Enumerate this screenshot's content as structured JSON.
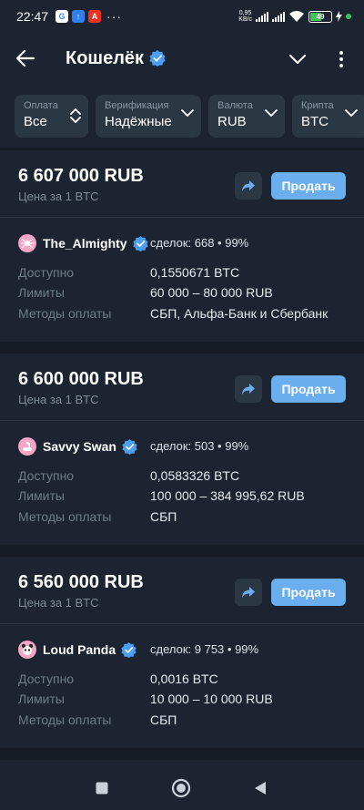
{
  "status_bar": {
    "time": "22:47",
    "net_speed_value": "0,95",
    "net_speed_unit": "KB/c",
    "battery": "49",
    "app_icons": [
      "google-icon",
      "upload-icon",
      "alfa-bank-icon"
    ],
    "more_dots": "···"
  },
  "header": {
    "title": "Кошелёк"
  },
  "filters": [
    {
      "label": "Оплата",
      "value": "Все"
    },
    {
      "label": "Верификация",
      "value": "Надёжные"
    },
    {
      "label": "Валюта",
      "value": "RUB"
    },
    {
      "label": "Крипта",
      "value": "BTC"
    }
  ],
  "offers": [
    {
      "price": "6 607 000 RUB",
      "price_sub": "Цена за 1 BTC",
      "sell_label": "Продать",
      "merchant": "The_Almighty",
      "deals": "сделок: 668 • 99%",
      "available_label": "Доступно",
      "available": "0,1550671 BTC",
      "limits_label": "Лимиты",
      "limits": "60 000 – 80 000 RUB",
      "methods_label": "Методы оплаты",
      "methods": "СБП, Альфа-Банк и Сбербанк"
    },
    {
      "price": "6 600 000 RUB",
      "price_sub": "Цена за 1 BTC",
      "sell_label": "Продать",
      "merchant": "Savvy Swan",
      "deals": "сделок: 503 • 99%",
      "available_label": "Доступно",
      "available": "0,0583326 BTC",
      "limits_label": "Лимиты",
      "limits": "100 000 – 384 995,62 RUB",
      "methods_label": "Методы оплаты",
      "methods": "СБП"
    },
    {
      "price": "6 560 000 RUB",
      "price_sub": "Цена за 1 BTC",
      "sell_label": "Продать",
      "merchant": "Loud Panda",
      "deals": "сделок: 9 753 • 99%",
      "available_label": "Доступно",
      "available": "0,0016 BTC",
      "limits_label": "Лимиты",
      "limits": "10 000 – 10 000 RUB",
      "methods_label": "Методы оплаты",
      "methods": "СБП"
    }
  ],
  "colors": {
    "background": "#141b24",
    "card": "#1b2430",
    "accent": "#6aaef0",
    "verified": "#4a9ff5"
  }
}
